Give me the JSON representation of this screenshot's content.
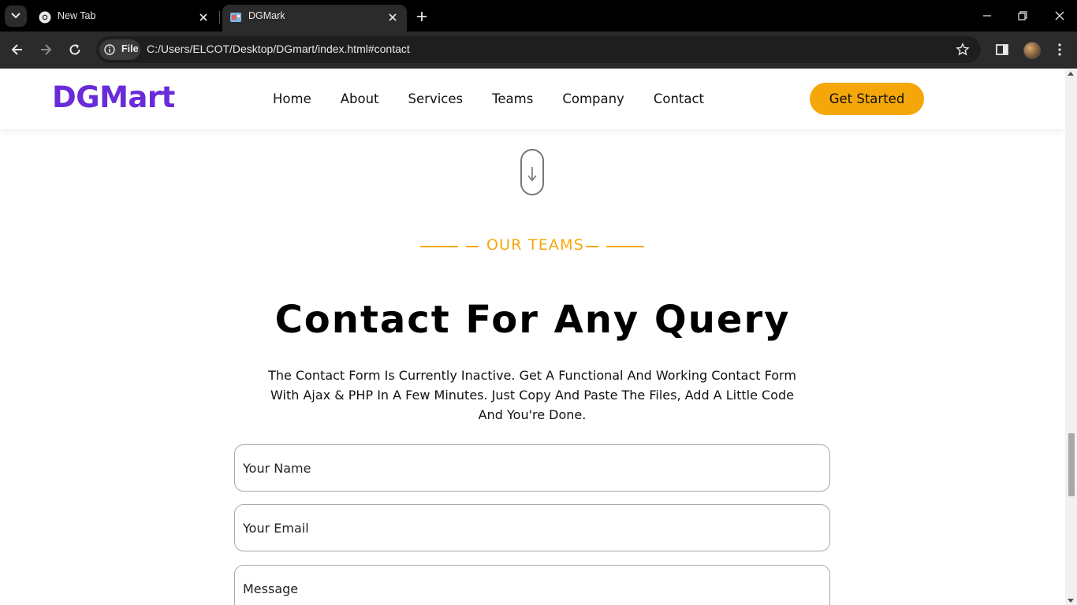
{
  "browser": {
    "tabs": [
      {
        "title": "New Tab",
        "active": false
      },
      {
        "title": "DGMark",
        "active": true
      }
    ],
    "file_chip_label": "File",
    "url": "C:/Users/ELCOT/Desktop/DGmart/index.html#contact"
  },
  "site": {
    "logo": "DGMart",
    "nav": [
      "Home",
      "About",
      "Services",
      "Teams",
      "Company",
      "Contact"
    ],
    "cta_label": "Get Started",
    "accent_color": "#f5a70a",
    "brand_color": "#6a2bd9"
  },
  "contact": {
    "eyebrow": "OUR TEAMS",
    "title": "Contact For Any Query",
    "description": "The Contact Form Is Currently Inactive. Get A Functional And Working Contact Form With Ajax & PHP In A Few Minutes. Just Copy And Paste The Files, Add A Little Code And You're Done.",
    "name_placeholder": "Your Name",
    "email_placeholder": "Your Email",
    "message_placeholder": "Message"
  }
}
